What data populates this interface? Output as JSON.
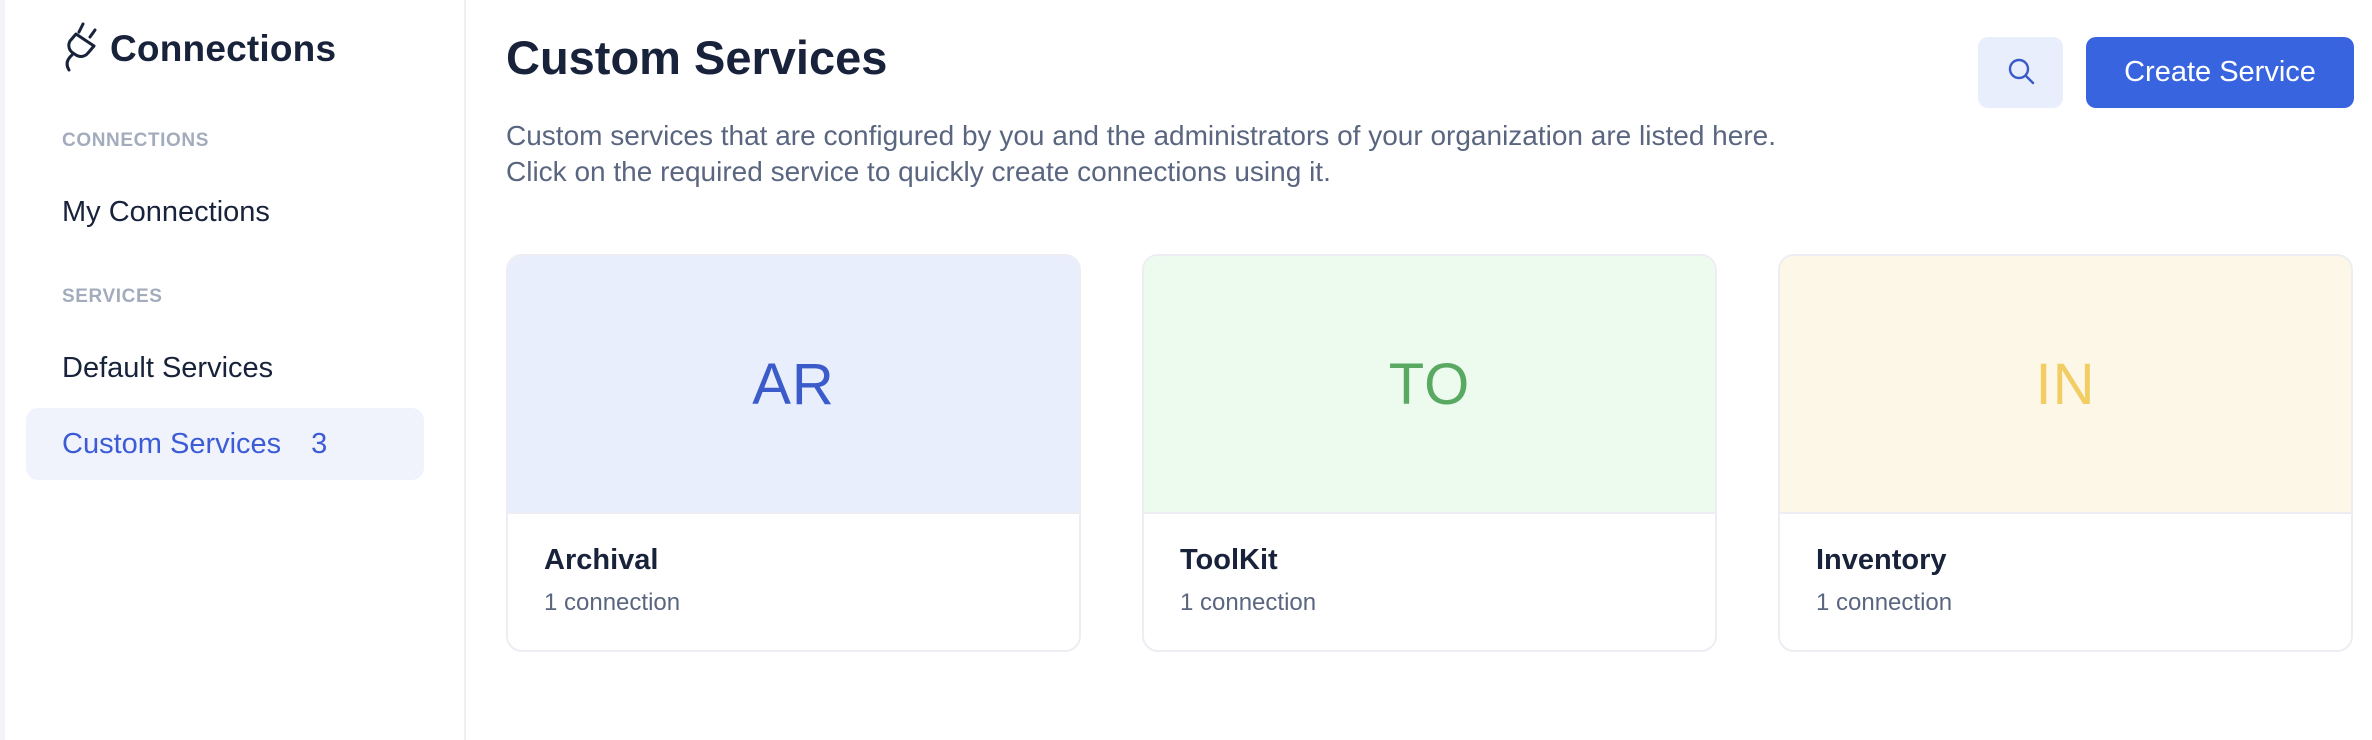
{
  "sidebar": {
    "title": "Connections",
    "sections": [
      {
        "label": "CONNECTIONS",
        "items": [
          {
            "label": "My Connections",
            "count": ""
          }
        ]
      },
      {
        "label": "SERVICES",
        "items": [
          {
            "label": "Default Services",
            "count": ""
          },
          {
            "label": "Custom Services",
            "count": "3",
            "active": true
          }
        ]
      }
    ]
  },
  "main": {
    "title": "Custom Services",
    "description_line1": "Custom services that are configured by you and the administrators of your organization are listed here.",
    "description_line2": "Click on the required service to quickly create connections using it.",
    "create_label": "Create Service",
    "cards": [
      {
        "initials": "AR",
        "name": "Archival",
        "meta": "1 connection",
        "banner_color": "#e8eefb",
        "initials_color": "#3a5bc9"
      },
      {
        "initials": "TO",
        "name": "ToolKit",
        "meta": "1 connection",
        "banner_color": "#ecfbee",
        "initials_color": "#5aa963"
      },
      {
        "initials": "IN",
        "name": "Inventory",
        "meta": "1 connection",
        "banner_color": "#fdf7e7",
        "initials_color": "#f2cd63"
      }
    ]
  },
  "colors": {
    "accent": "#3864e0",
    "active_nav_bg": "#f1f3fc",
    "search_bg": "#e8eefc"
  },
  "icons": {
    "brand": "plug-icon",
    "search": "search-icon"
  }
}
